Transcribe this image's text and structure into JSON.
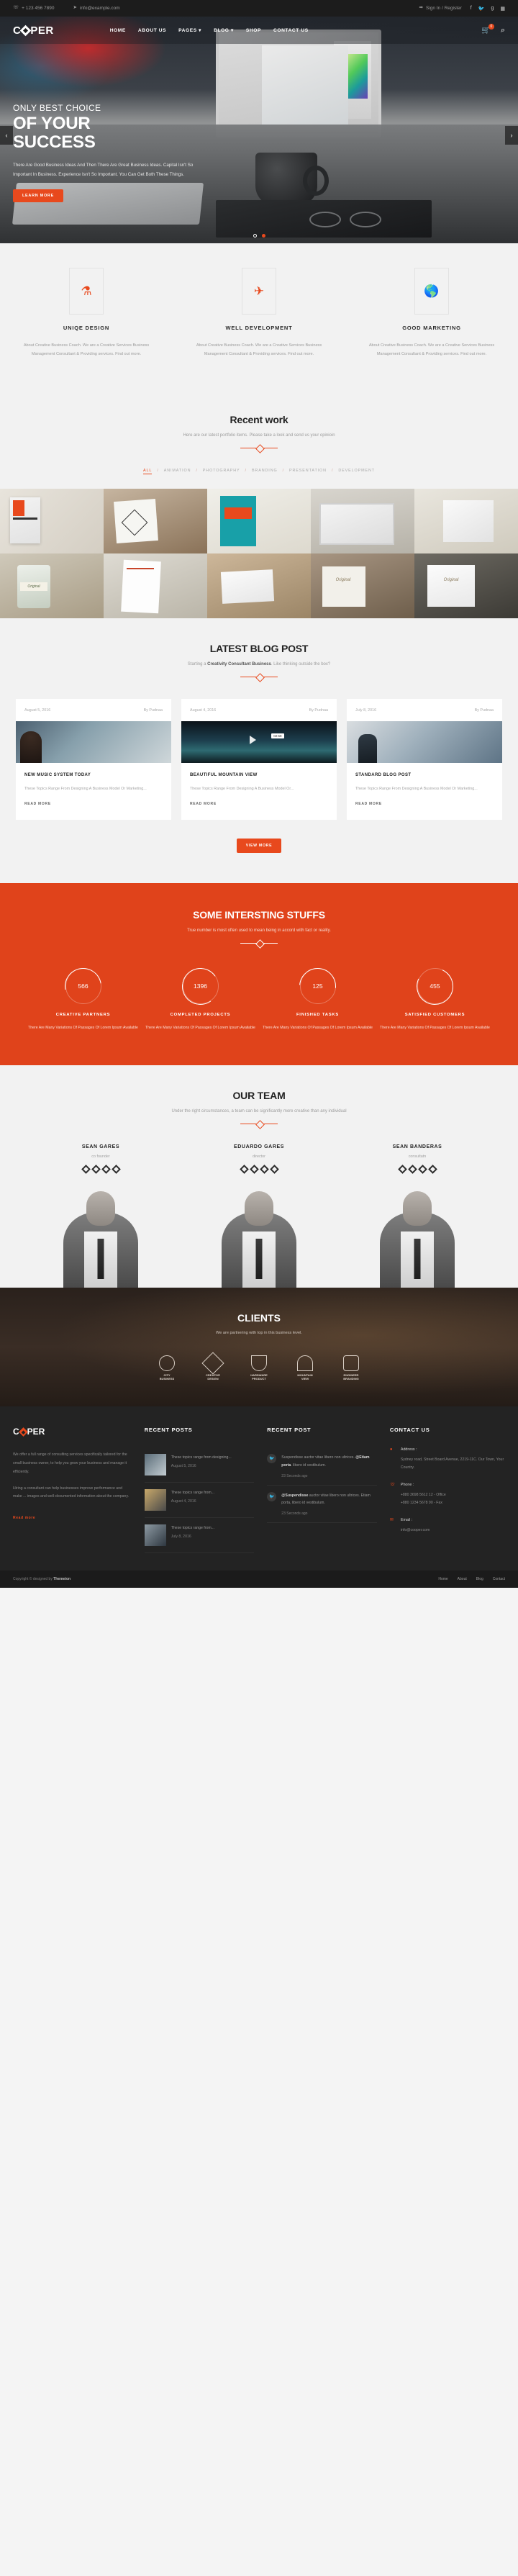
{
  "topbar": {
    "phone": "+ 123 456 7890",
    "email": "info@example.com",
    "phone_icon": "phone-icon",
    "email_icon": "paper-plane-icon",
    "signin": "Sign In / Register",
    "signin_icon": "sign-in-icon",
    "social": [
      "f",
      "t",
      "g",
      "b"
    ]
  },
  "header": {
    "logo": "COOPER",
    "logo_left": "C",
    "logo_right": "PER",
    "nav": [
      {
        "label": "HOME",
        "caret": false
      },
      {
        "label": "ABOUT US",
        "caret": false
      },
      {
        "label": "PAGES",
        "caret": true
      },
      {
        "label": "BLOG",
        "caret": true
      },
      {
        "label": "SHOP",
        "caret": false
      },
      {
        "label": "CONTACT US",
        "caret": false
      }
    ],
    "cart_count": "0",
    "cart_icon": "cart-icon",
    "search_icon": "search-icon"
  },
  "hero": {
    "subtitle": "ONLY BEST CHOICE",
    "title_line1": "OF YOUR",
    "title_line2": "SUCCESS",
    "text": "There Are Good Business Ideas And Then There Are Great Business Ideas. Capital Isn't So Important In Business. Experience Isn't So Important. You Can Get Both These Things.",
    "button": "LEARN MORE",
    "prev_icon": "chevron-left-icon",
    "next_icon": "chevron-right-icon",
    "slides": 2,
    "active_slide": 2
  },
  "services": [
    {
      "icon": "flask-icon",
      "glyph": "⚗",
      "title": "UNIQE DESIGN",
      "desc": "About Creative Business Coach. We are a Creative Services Business Management Consultant & Providing services. Find out more."
    },
    {
      "icon": "plane-icon",
      "glyph": "✈",
      "title": "WELL DEVELOPMENT",
      "desc": "About Creative Business Coach. We are a Creative Services Business Management Consultant & Providing services. Find out more."
    },
    {
      "icon": "globe-icon",
      "glyph": "ἱ0",
      "title": "GOOD MARKETING",
      "desc": "About Creative Business Coach. We are a Creative Services Business Management Consultant & Providing services. Find out more."
    }
  ],
  "portfolio": {
    "title": "Recent work",
    "subtitle": "Here are our latest portfolio items. Please take a look and send us your opinioin",
    "filters": [
      "ALL",
      "ANIMATION",
      "PHOTOGRAPHY",
      "BRANDING",
      "PRESENTATION",
      "DEVELOPMENT"
    ],
    "active_filter": "ALL",
    "separator": "/"
  },
  "blog": {
    "title": "LATEST BLOG POST",
    "subtitle_pre": "Starting a ",
    "subtitle_bold": "Creativity Consultant Business",
    "subtitle_post": ". Like thinking outside the box?",
    "view_more": "VIEW MORE",
    "posts": [
      {
        "date": "August 5, 2016",
        "author": "By Pudnaa",
        "title": "NEW MUSIC SYSTEM TODAY",
        "excerpt": "These Topics Range From Designing A Business Model Or Marketing...",
        "read_more": "READ MORE",
        "video_time": ""
      },
      {
        "date": "August 4, 2016",
        "author": "By Pudnaa",
        "title": "BEAUTIFUL MOUNTAIN VIEW",
        "excerpt": "These Topics Range From Designing A Business Model Or...",
        "read_more": "READ MORE",
        "video_time": "02:58"
      },
      {
        "date": "July 8, 2016",
        "author": "By Pudnaa",
        "title": "STANDARD BLOG POST",
        "excerpt": "These Topics Range From Designing A Business Model Or Marketing...",
        "read_more": "READ MORE",
        "video_time": ""
      }
    ]
  },
  "counters": {
    "title": "SOME INTERSTING STUFFS",
    "subtitle": "True number is most often used to mean being in accord with fact or reality.",
    "items": [
      {
        "value": "566",
        "label": "CREATIVE PARTNERS",
        "desc": "There Are Many Variations Of Passages Of Lorem Ipsum Available"
      },
      {
        "value": "1396",
        "label": "COMPLETED PROJECTS",
        "desc": "There Are Many Variations Of Passages Of Lorem Ipsum Available"
      },
      {
        "value": "125",
        "label": "FINISHED TASKS",
        "desc": "There Are Many Variations Of Passages Of Lorem Ipsum Available"
      },
      {
        "value": "455",
        "label": "SATISFIED CUSTOMERS",
        "desc": "There Are Many Variations Of Passages Of Lorem Ipsum Available"
      }
    ]
  },
  "team": {
    "title": "OUR TEAM",
    "subtitle": "Under the right circumstances, a team can be significantly more creative than any individual",
    "members": [
      {
        "name": "SEAN GARES",
        "role": "co founder"
      },
      {
        "name": "EDUARDO GARES",
        "role": "director"
      },
      {
        "name": "SEAN BANDERAS",
        "role": "consultatn"
      }
    ]
  },
  "clients": {
    "title": "CLIENTS",
    "subtitle": "We are partnering with top in this business level.",
    "logos": [
      {
        "line1": "CITY",
        "line2": "BUSINESS"
      },
      {
        "line1": "CREATIVE",
        "line2": "DESIGN"
      },
      {
        "line1": "HARDWARE",
        "line2": "PRODUCT"
      },
      {
        "line1": "MOUNTAIN",
        "line2": "VIEW"
      },
      {
        "line1": "ENGINEER",
        "line2": "BRANDING"
      }
    ]
  },
  "footer": {
    "brand_left": "C",
    "brand_right": "PER",
    "about_p1": "We offer a full range of consulting services specifically tailored for the small business owner, to help you grow your business and manage it efficiently.",
    "about_p2": "Hiring a consultant can help businesses improve performance and make ... images and well-documented information about the company.",
    "read_more": "Read more",
    "recent_posts_title": "RECENT POSTS",
    "recent_posts": [
      {
        "text": "These topics range from designing...",
        "date": "August 5, 2016"
      },
      {
        "text": "These topics range from...",
        "date": "August 4, 2016"
      },
      {
        "text": "These topics range from...",
        "date": "July 8, 2016"
      }
    ],
    "recent_post_title": "RECENT POST",
    "tweets": [
      {
        "pre": "Suspendisse auctor vitae libero non ultrices. ",
        "bold": "@Etiam porta",
        "post": ". libero id vestibulum.",
        "ago": "23 Seconds ago",
        "icon": "twitter-icon"
      },
      {
        "pre": "",
        "bold": "@Suspendisse",
        "post": " auctor vitae libero non ultrices. Etiam porta, libero id vestibulum.",
        "ago": "23 Seconds ago",
        "icon": "twitter-icon"
      }
    ],
    "contact_title": "CONTACT US",
    "contact": [
      {
        "icon": "map-pin-icon",
        "glyph": "◉",
        "label": "Address :",
        "value": "Sydney road, Street Board Avenue, 2219-11C. Our Town, Your Country."
      },
      {
        "icon": "phone-icon",
        "glyph": "☎",
        "label": "Phone :",
        "value": "+880 3698 5612 12 - Office\n+880 1234 5678 90 - Fax"
      },
      {
        "icon": "envelope-icon",
        "glyph": "✉",
        "label": "Email :",
        "value": "info@cooper.com"
      }
    ],
    "bottom_left_pre": "Copyright © designed by ",
    "bottom_left_bold": "Themeton",
    "bottom_nav": [
      "Home",
      "About",
      "Blog",
      "Contact"
    ]
  }
}
